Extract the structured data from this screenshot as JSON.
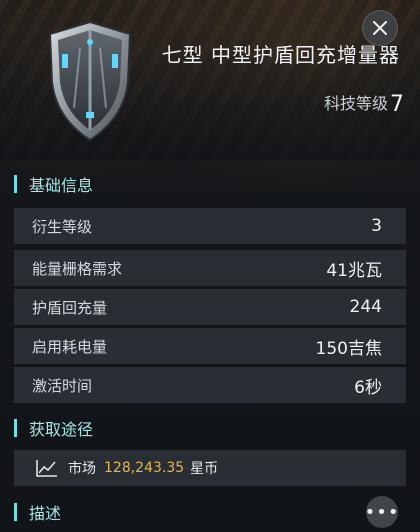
{
  "item": {
    "title": "七型 中型护盾回充增量器",
    "tech_label": "科技等级",
    "tech_level": "7",
    "icon": "shield-module-icon"
  },
  "sections": {
    "basic": "基础信息",
    "source": "获取途径",
    "desc": "描述"
  },
  "stats": [
    {
      "label": "衍生等级",
      "value": "3"
    },
    {
      "label": "能量栅格需求",
      "value": "41兆瓦"
    },
    {
      "label": "护盾回充量",
      "value": "244"
    },
    {
      "label": "启用耗电量",
      "value": "150吉焦"
    },
    {
      "label": "激活时间",
      "value": "6秒"
    }
  ],
  "market": {
    "label": "市场",
    "price": "128,243.35",
    "unit": "星币",
    "icon": "trend-chart-icon",
    "price_color": "#e8b54a"
  },
  "buttons": {
    "close_icon": "close-icon",
    "more_icon": "more-icon",
    "more_glyph": "•••"
  },
  "colors": {
    "accent": "#6fe0e0",
    "section_text": "#a6e6e6"
  }
}
